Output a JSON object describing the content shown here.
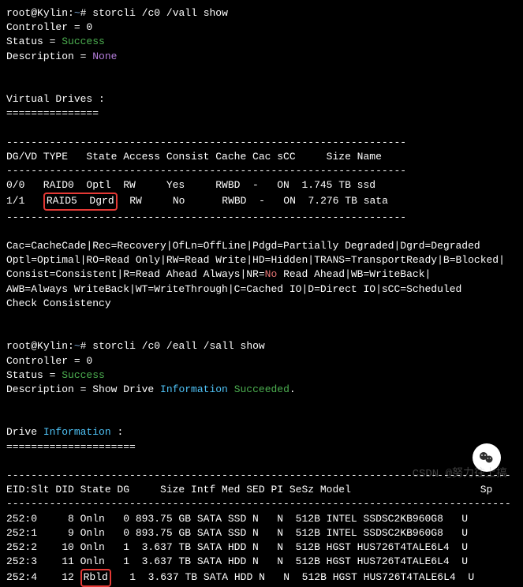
{
  "prompt1": {
    "user": "root",
    "host": "Kylin",
    "path": "~",
    "cmd": "storcli /c0 /vall show"
  },
  "block1": {
    "controller_label": "Controller = ",
    "controller_val": "0",
    "status_label": "Status = ",
    "status_val": "Success",
    "desc_label": "Description = ",
    "desc_val": "None"
  },
  "vdrives": {
    "title": "Virtual Drives :",
    "sep": "===============",
    "header": "DG/VD TYPE   State Access Consist Cache Cac sCC     Size Name",
    "divider": "-----------------------------------------------------------------",
    "row0": "0/0   RAID0  Optl  RW     Yes     RWBD  -   ON  1.745 TB ssd",
    "row1_pre": "1/1   ",
    "row1_boxed": "RAID5  Dgrd",
    "row1_post": "  RW     No      RWBD  -   ON  7.276 TB sata",
    "legend1": "Cac=CacheCade|Rec=Recovery|OfLn=OffLine|Pdgd=Partially Degraded|Dgrd=Degraded",
    "legend2": "Optl=Optimal|RO=Read Only|RW=Read Write|HD=Hidden|TRANS=TransportReady|B=Blocked|",
    "legend3a": "Consist=Consistent|R=Read Ahead Always|NR=",
    "legend3_no": "No",
    "legend3b": " Read Ahead|WB=WriteBack|",
    "legend4": "AWB=Always WriteBack|WT=WriteThrough|C=Cached IO|D=Direct IO|sCC=Scheduled",
    "legend5": "Check Consistency"
  },
  "prompt2": {
    "user": "root",
    "host": "Kylin",
    "path": "~",
    "cmd": "storcli /c0 /eall /sall show"
  },
  "block2": {
    "controller_label": "Controller = ",
    "controller_val": "0",
    "status_label": "Status = ",
    "status_val": "Success",
    "desc_pre": "Description = Show Drive ",
    "desc_info": "Information",
    "desc_mid": " ",
    "desc_succ": "Succeeded",
    "desc_end": "."
  },
  "drives": {
    "title_pre": "Drive ",
    "title_info": "Information",
    "title_post": " :",
    "sep": "=====================",
    "divider": "----------------------------------------------------------------------------------",
    "header": "EID:Slt DID State DG     Size Intf Med SED PI SeSz Model                     Sp",
    "rows": [
      "252:0     8 Onln   0 893.75 GB SATA SSD N   N  512B INTEL SSDSC2KB960G8   U",
      "252:1     9 Onln   0 893.75 GB SATA SSD N   N  512B INTEL SSDSC2KB960G8   U",
      "252:2    10 Onln   1  3.637 TB SATA HDD N   N  512B HGST HUS726T4TALE6L4  U",
      "252:3    11 Onln   1  3.637 TB SATA HDD N   N  512B HGST HUS726T4TALE6L4  U"
    ],
    "row4_pre": "252:4    12 ",
    "row4_boxed": "Rbld",
    "row4_post": "   1  3.637 TB SATA HDD N   N  512B HGST HUS726T4TALE6L4  U"
  },
  "watermark": "CSDN @努力往上搞"
}
